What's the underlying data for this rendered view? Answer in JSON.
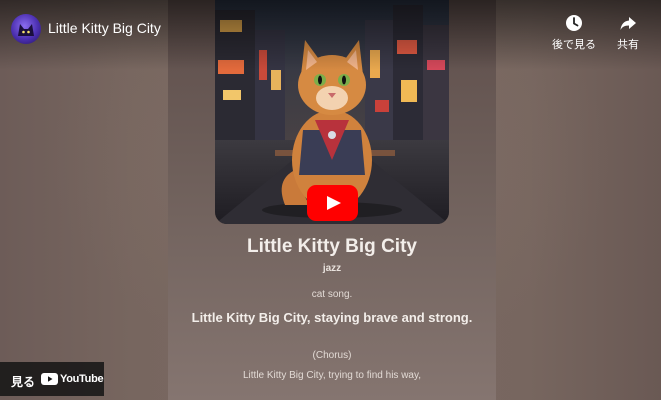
{
  "header": {
    "video_title": "Little Kitty Big City",
    "watch_later_label": "後で見る",
    "share_label": "共有"
  },
  "card": {
    "song_title": "Little Kitty Big City",
    "genre": "jazz",
    "lyrics": {
      "line1": "cat song.",
      "line2": "Little Kitty Big City, staying brave and strong.",
      "line3": "(Chorus)",
      "line4": "Little Kitty Big City, trying to find his way,"
    }
  },
  "footer": {
    "watch_label": "見る",
    "youtube_label": "YouTube"
  },
  "colors": {
    "play_button": "#ff0000",
    "text": "#ffffff"
  },
  "icons": [
    "clock-icon",
    "share-arrow-icon",
    "play-icon",
    "youtube-logo-icon"
  ]
}
